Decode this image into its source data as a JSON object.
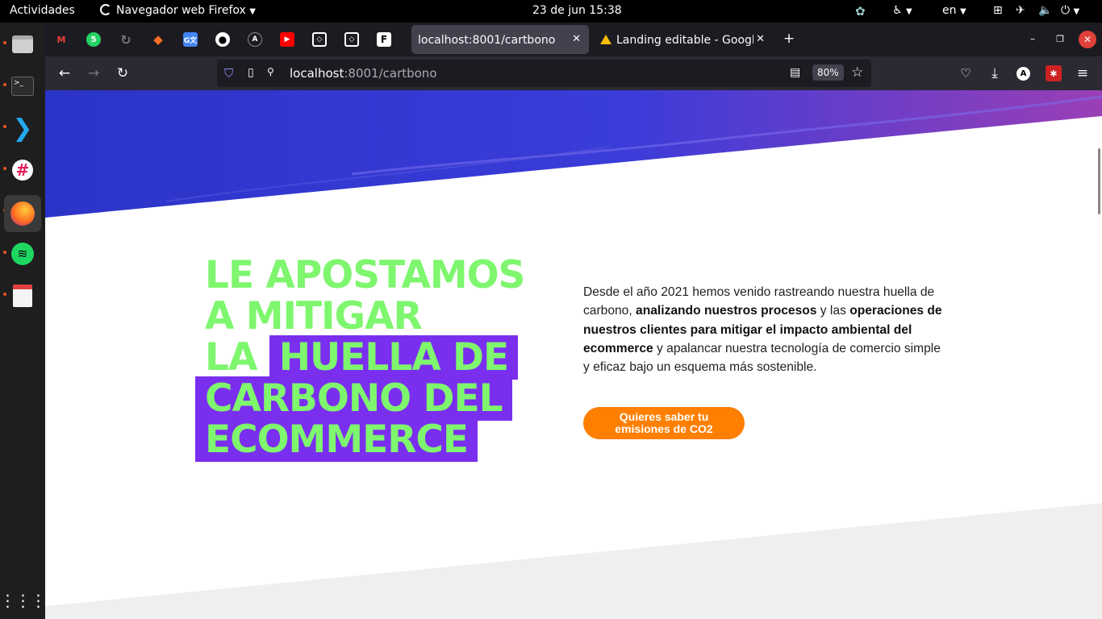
{
  "system_bar": {
    "activities": "Actividades",
    "app_name": "Navegador web Firefox",
    "datetime": "23 de jun  15:38",
    "language": "en"
  },
  "dock": {
    "items": [
      "files",
      "terminal",
      "vscode",
      "slack",
      "firefox",
      "spotify",
      "text-editor"
    ],
    "show_apps": "show-applications"
  },
  "tabs": [
    {
      "title": "localhost:8001/cartbono",
      "active": true
    },
    {
      "title": "Landing editable - Google",
      "active": false
    }
  ],
  "pinned": [
    "gmail",
    "whatsapp",
    "refresh-app",
    "gitlab",
    "google-translate",
    "github",
    "appwrite",
    "youtube",
    "codesandbox",
    "codesandbox",
    "frame"
  ],
  "whatsapp_badge": "5",
  "navigation": {
    "url_host": "localhost",
    "url_rest": ":8001/cartbono",
    "zoom": "80%"
  },
  "hero": {
    "line1": "LE APOSTAMOS",
    "line2": "A MITIGAR",
    "line3_plain": "LA",
    "line3_highlight": "HUELLA DE",
    "line4": "CARBONO DEL",
    "line5": "ECOMMERCE"
  },
  "description": {
    "p1": "Desde el año 2021 hemos venido rastreando nuestra huella de carbono, ",
    "b1": "analizando nuestros procesos",
    "p2": " y las ",
    "b2": "operaciones de nuestros clientes para mitigar el impacto ambiental del ecommerce",
    "p3": " y apalancar nuestra tecnología de comercio simple y eficaz bajo un esquema más sostenible."
  },
  "cta": {
    "line1": "Quieres saber tu",
    "line2": "emisiones de CO2"
  },
  "colors": {
    "hero_text": "#7ef66e",
    "highlight": "#7a2fee",
    "cta": "#ff7f00"
  }
}
